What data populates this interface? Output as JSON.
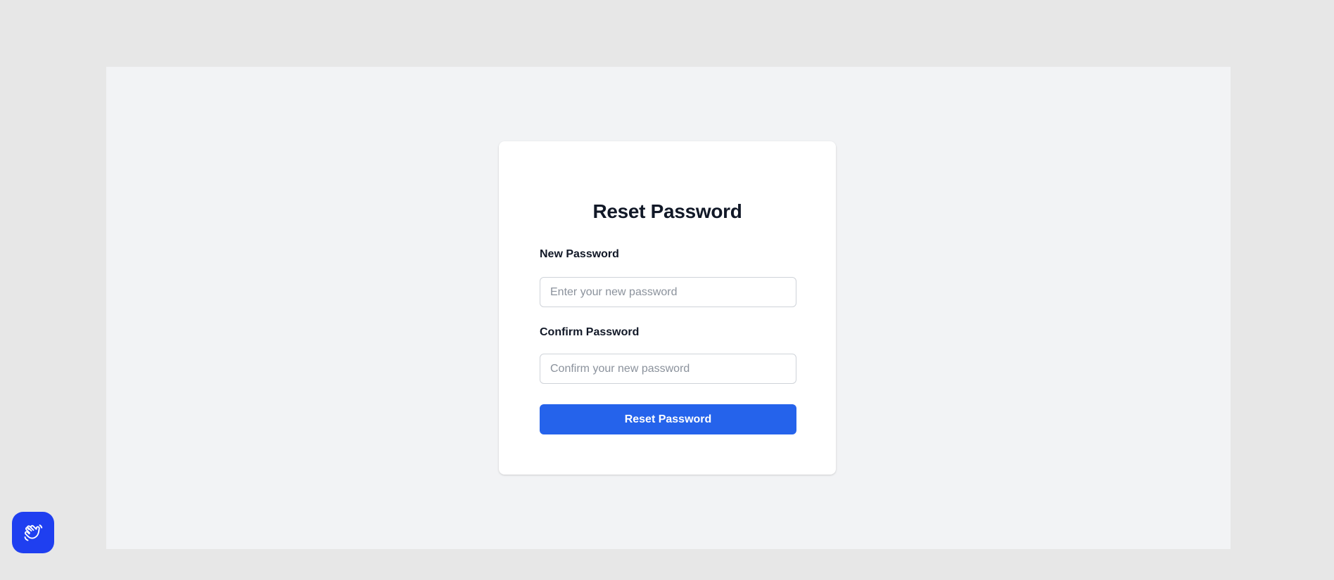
{
  "form": {
    "title": "Reset Password",
    "new_password": {
      "label": "New Password",
      "value": "",
      "placeholder": "Enter your new password"
    },
    "confirm_password": {
      "label": "Confirm Password",
      "value": "",
      "placeholder": "Confirm your new password"
    },
    "submit_label": "Reset Password"
  },
  "widget": {
    "icon": "waving-hand-icon"
  },
  "colors": {
    "page_background": "#e7e7e7",
    "stage_background": "#f2f3f5",
    "card_background": "#ffffff",
    "primary": "#2563eb",
    "widget": "#1f3ff0",
    "heading_text": "#111827",
    "placeholder_text": "#8b929c"
  }
}
